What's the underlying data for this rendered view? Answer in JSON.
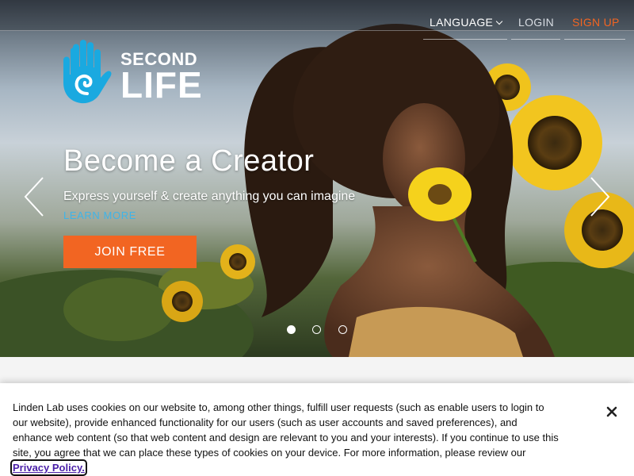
{
  "nav": {
    "language_label": "LANGUAGE",
    "login_label": "LOGIN",
    "signup_label": "SIGN UP",
    "language_icon": "chevron-down-icon"
  },
  "brand": {
    "name_top": "SECOND",
    "name_bottom": "LIFE",
    "trademark": "™",
    "logo_icon": "hand-spiral-icon",
    "logo_color": "#1aa9e0"
  },
  "hero": {
    "headline": "Become a Creator",
    "subheadline": "Express yourself & create anything you can imagine",
    "learn_more_label": "LEARN MORE",
    "join_label": "JOIN FREE",
    "prev_icon": "chevron-left-icon",
    "next_icon": "chevron-right-icon",
    "slides_count": 3,
    "active_slide": 1
  },
  "cookie_banner": {
    "text": "Linden Lab uses cookies on our website to, among other things, fulfill user requests (such as enable users to login to our website), provide enhanced functionality for our users (such as user accounts and saved preferences), and enhance web content (so that web content and design are relevant to you and your interests). If you continue to use this site, you agree that we can place these types of cookies on your device. For more information, please review our ",
    "privacy_link_label": "Privacy Policy.",
    "close_icon": "close-icon"
  },
  "colors": {
    "accent_orange": "#f26522",
    "link_blue": "#3fb4e8",
    "privacy_link": "#4a1fa8"
  }
}
